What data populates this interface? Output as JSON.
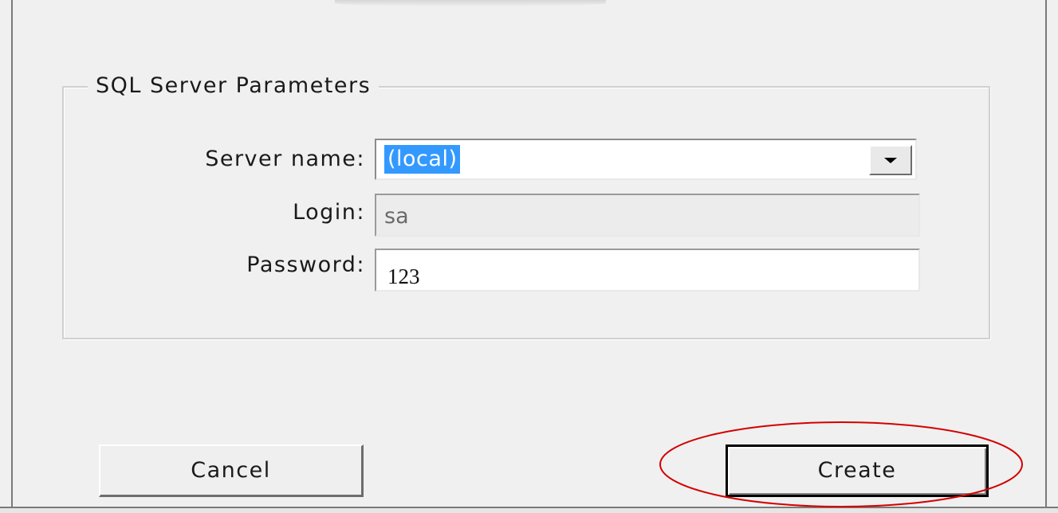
{
  "groupbox": {
    "legend": "SQL Server Parameters"
  },
  "server": {
    "label": "Server name:",
    "value": "(local)"
  },
  "login": {
    "label": "Login:",
    "value": "sa"
  },
  "password": {
    "label": "Password:",
    "value": "123"
  },
  "buttons": {
    "cancel_label": "Cancel",
    "create_label": "Create"
  },
  "colors": {
    "selection": "#3399ff",
    "annotation": "#d40000"
  },
  "icons": {
    "dropdown": "chevron-down-icon"
  }
}
